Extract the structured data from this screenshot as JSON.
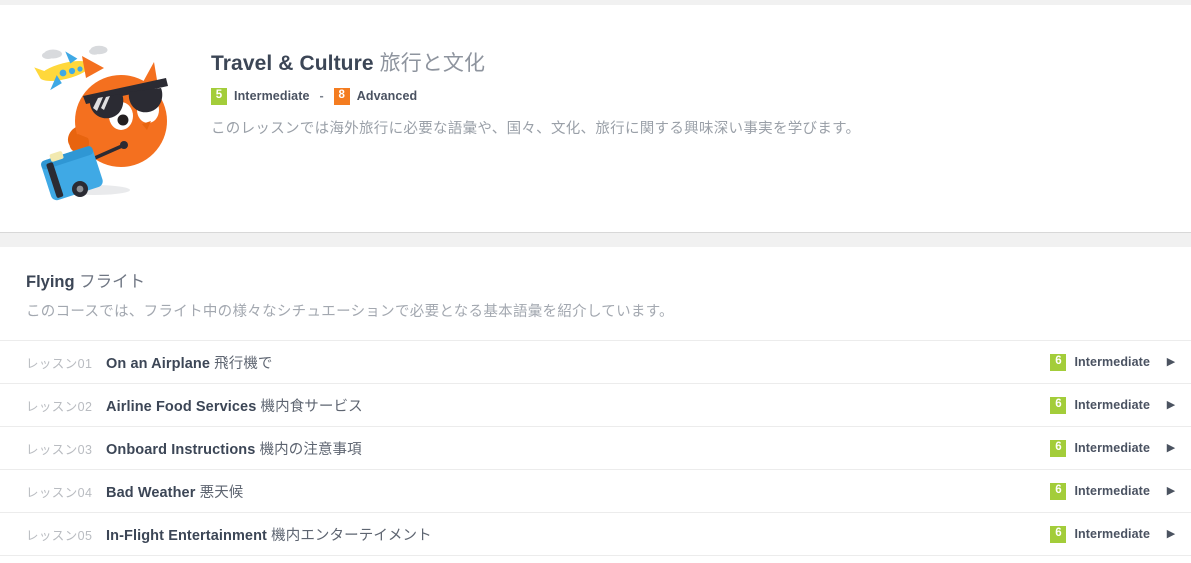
{
  "header": {
    "title_en": "Travel & Culture ",
    "title_jp": "旅行と文化",
    "level_low_num": "5",
    "level_low_name": "Intermediate",
    "level_separator": "-",
    "level_high_num": "8",
    "level_high_name": "Advanced",
    "description": "このレッスンでは海外旅行に必要な語彙や、国々、文化、旅行に関する興味深い事実を学びます。",
    "mascot_alt": "cat-traveler-mascot-icon"
  },
  "course": {
    "name_en": "Flying ",
    "name_jp": "フライト",
    "description": "このコースでは、フライト中の様々なシチュエーションで必要となる基本語彙を紹介しています。"
  },
  "lessons": [
    {
      "number": "レッスン01",
      "title_en": "On an Airplane ",
      "title_jp": "飛行機で",
      "level_num": "6",
      "level_name": "Intermediate",
      "chevron": "▶"
    },
    {
      "number": "レッスン02",
      "title_en": "Airline Food Services ",
      "title_jp": "機内食サービス",
      "level_num": "6",
      "level_name": "Intermediate",
      "chevron": "▶"
    },
    {
      "number": "レッスン03",
      "title_en": "Onboard Instructions ",
      "title_jp": "機内の注意事項",
      "level_num": "6",
      "level_name": "Intermediate",
      "chevron": "▶"
    },
    {
      "number": "レッスン04",
      "title_en": "Bad Weather ",
      "title_jp": "悪天候",
      "level_num": "6",
      "level_name": "Intermediate",
      "chevron": "▶"
    },
    {
      "number": "レッスン05",
      "title_en": "In-Flight Entertainment ",
      "title_jp": "機内エンターテイメント",
      "level_num": "6",
      "level_name": "Intermediate",
      "chevron": "▶"
    }
  ],
  "colors": {
    "level_green": "#a3cd3a",
    "level_orange": "#f47c20",
    "mascot_orange": "#f4701f",
    "mascot_blue": "#3fa9e5",
    "mascot_yellow": "#ffd83b",
    "band_gray": "#f1f1f1"
  }
}
